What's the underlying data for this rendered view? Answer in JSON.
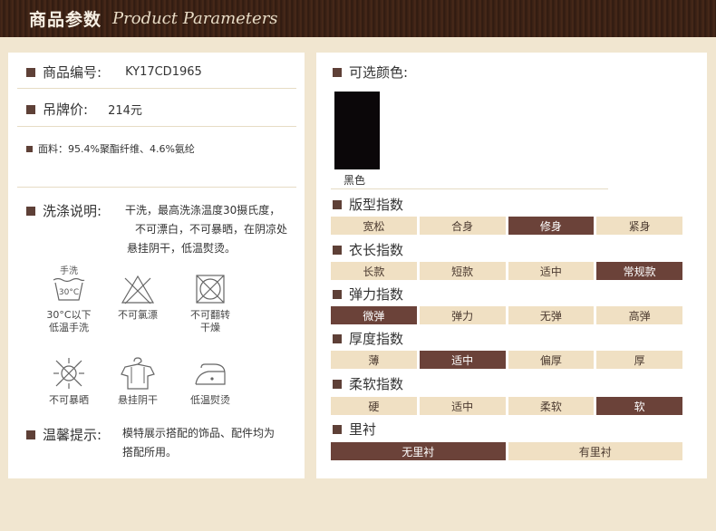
{
  "header": {
    "title_cn": "商品参数",
    "title_en": "Product Parameters"
  },
  "left": {
    "product_code": {
      "label": "商品编号:",
      "value": "KY17CD1965"
    },
    "tag_price": {
      "label": "吊牌价:",
      "value": "214元"
    },
    "fabric": {
      "label": "面料：",
      "value": "95.4%聚酯纤维、4.6%氨纶"
    },
    "wash": {
      "label": "洗涤说明:",
      "lines": [
        "干洗，最高洗涤温度30摄氏度，",
        "不可漂白，不可暴晒，在阴凉处",
        "悬挂阴干，低温熨烫。"
      ]
    },
    "care_icons": [
      {
        "icon": "hand-wash-30-icon",
        "top_text": "手洗",
        "inner_text": "30°C",
        "label_lines": [
          "30°C以下",
          "低温手洗"
        ]
      },
      {
        "icon": "no-bleach-icon",
        "label_lines": [
          "不可氯漂"
        ]
      },
      {
        "icon": "no-tumble-dry-icon",
        "label_lines": [
          "不可翻转",
          "干燥"
        ]
      },
      {
        "icon": "no-sun-icon",
        "label_lines": [
          "不可暴晒"
        ]
      },
      {
        "icon": "hang-dry-icon",
        "label_lines": [
          "悬挂阴干"
        ]
      },
      {
        "icon": "low-iron-icon",
        "label_lines": [
          "低温熨烫"
        ]
      }
    ],
    "tip": {
      "label": "温馨提示:",
      "lines": [
        "模特展示搭配的饰品、配件均为",
        "搭配所用。"
      ]
    }
  },
  "right": {
    "colors_label": "可选颜色:",
    "colors": [
      {
        "name": "黑色",
        "hex": "#0b0709"
      }
    ],
    "scales": [
      {
        "label": "版型指数",
        "options": [
          "宽松",
          "合身",
          "修身",
          "紧身"
        ],
        "selected": 2
      },
      {
        "label": "衣长指数",
        "options": [
          "长款",
          "短款",
          "适中",
          "常规款"
        ],
        "selected": 3
      },
      {
        "label": "弹力指数",
        "options": [
          "微弹",
          "弹力",
          "无弹",
          "高弹"
        ],
        "selected": 0
      },
      {
        "label": "厚度指数",
        "options": [
          "薄",
          "适中",
          "偏厚",
          "厚"
        ],
        "selected": 1
      },
      {
        "label": "柔软指数",
        "options": [
          "硬",
          "适中",
          "柔软",
          "软"
        ],
        "selected": 3
      },
      {
        "label": "里衬",
        "options": [
          "无里衬",
          "有里衬"
        ],
        "selected": 0
      }
    ]
  },
  "colors": {
    "accent": "#6b4239",
    "cell_bg": "#f0e0c3",
    "page_bg": "#f1e6d0",
    "header_bg": "#3a2114"
  }
}
